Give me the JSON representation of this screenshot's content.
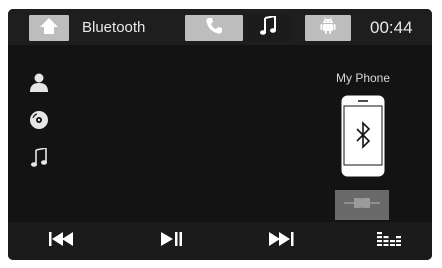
{
  "header": {
    "title": "Bluetooth",
    "time": "00:44",
    "tabs": [
      {
        "icon": "phone-icon",
        "active": true
      },
      {
        "icon": "music-note-icon",
        "active": false
      },
      {
        "icon": "android-icon",
        "active": true
      }
    ]
  },
  "sidebar": {
    "items": [
      {
        "icon": "contact-person-icon"
      },
      {
        "icon": "disc-icon"
      },
      {
        "icon": "music-note-icon"
      }
    ]
  },
  "device": {
    "name": "My Phone",
    "icon": "bluetooth-phone-icon",
    "connect_icon": "connect-icon"
  },
  "controls": {
    "items": [
      {
        "icon": "previous-icon"
      },
      {
        "icon": "play-pause-icon"
      },
      {
        "icon": "next-icon"
      },
      {
        "icon": "equalizer-icon"
      }
    ]
  },
  "colors": {
    "background": "#131313",
    "bar": "#1e1e1e",
    "active_button": "#bdbdbd",
    "icon": "#e6e6e6"
  }
}
